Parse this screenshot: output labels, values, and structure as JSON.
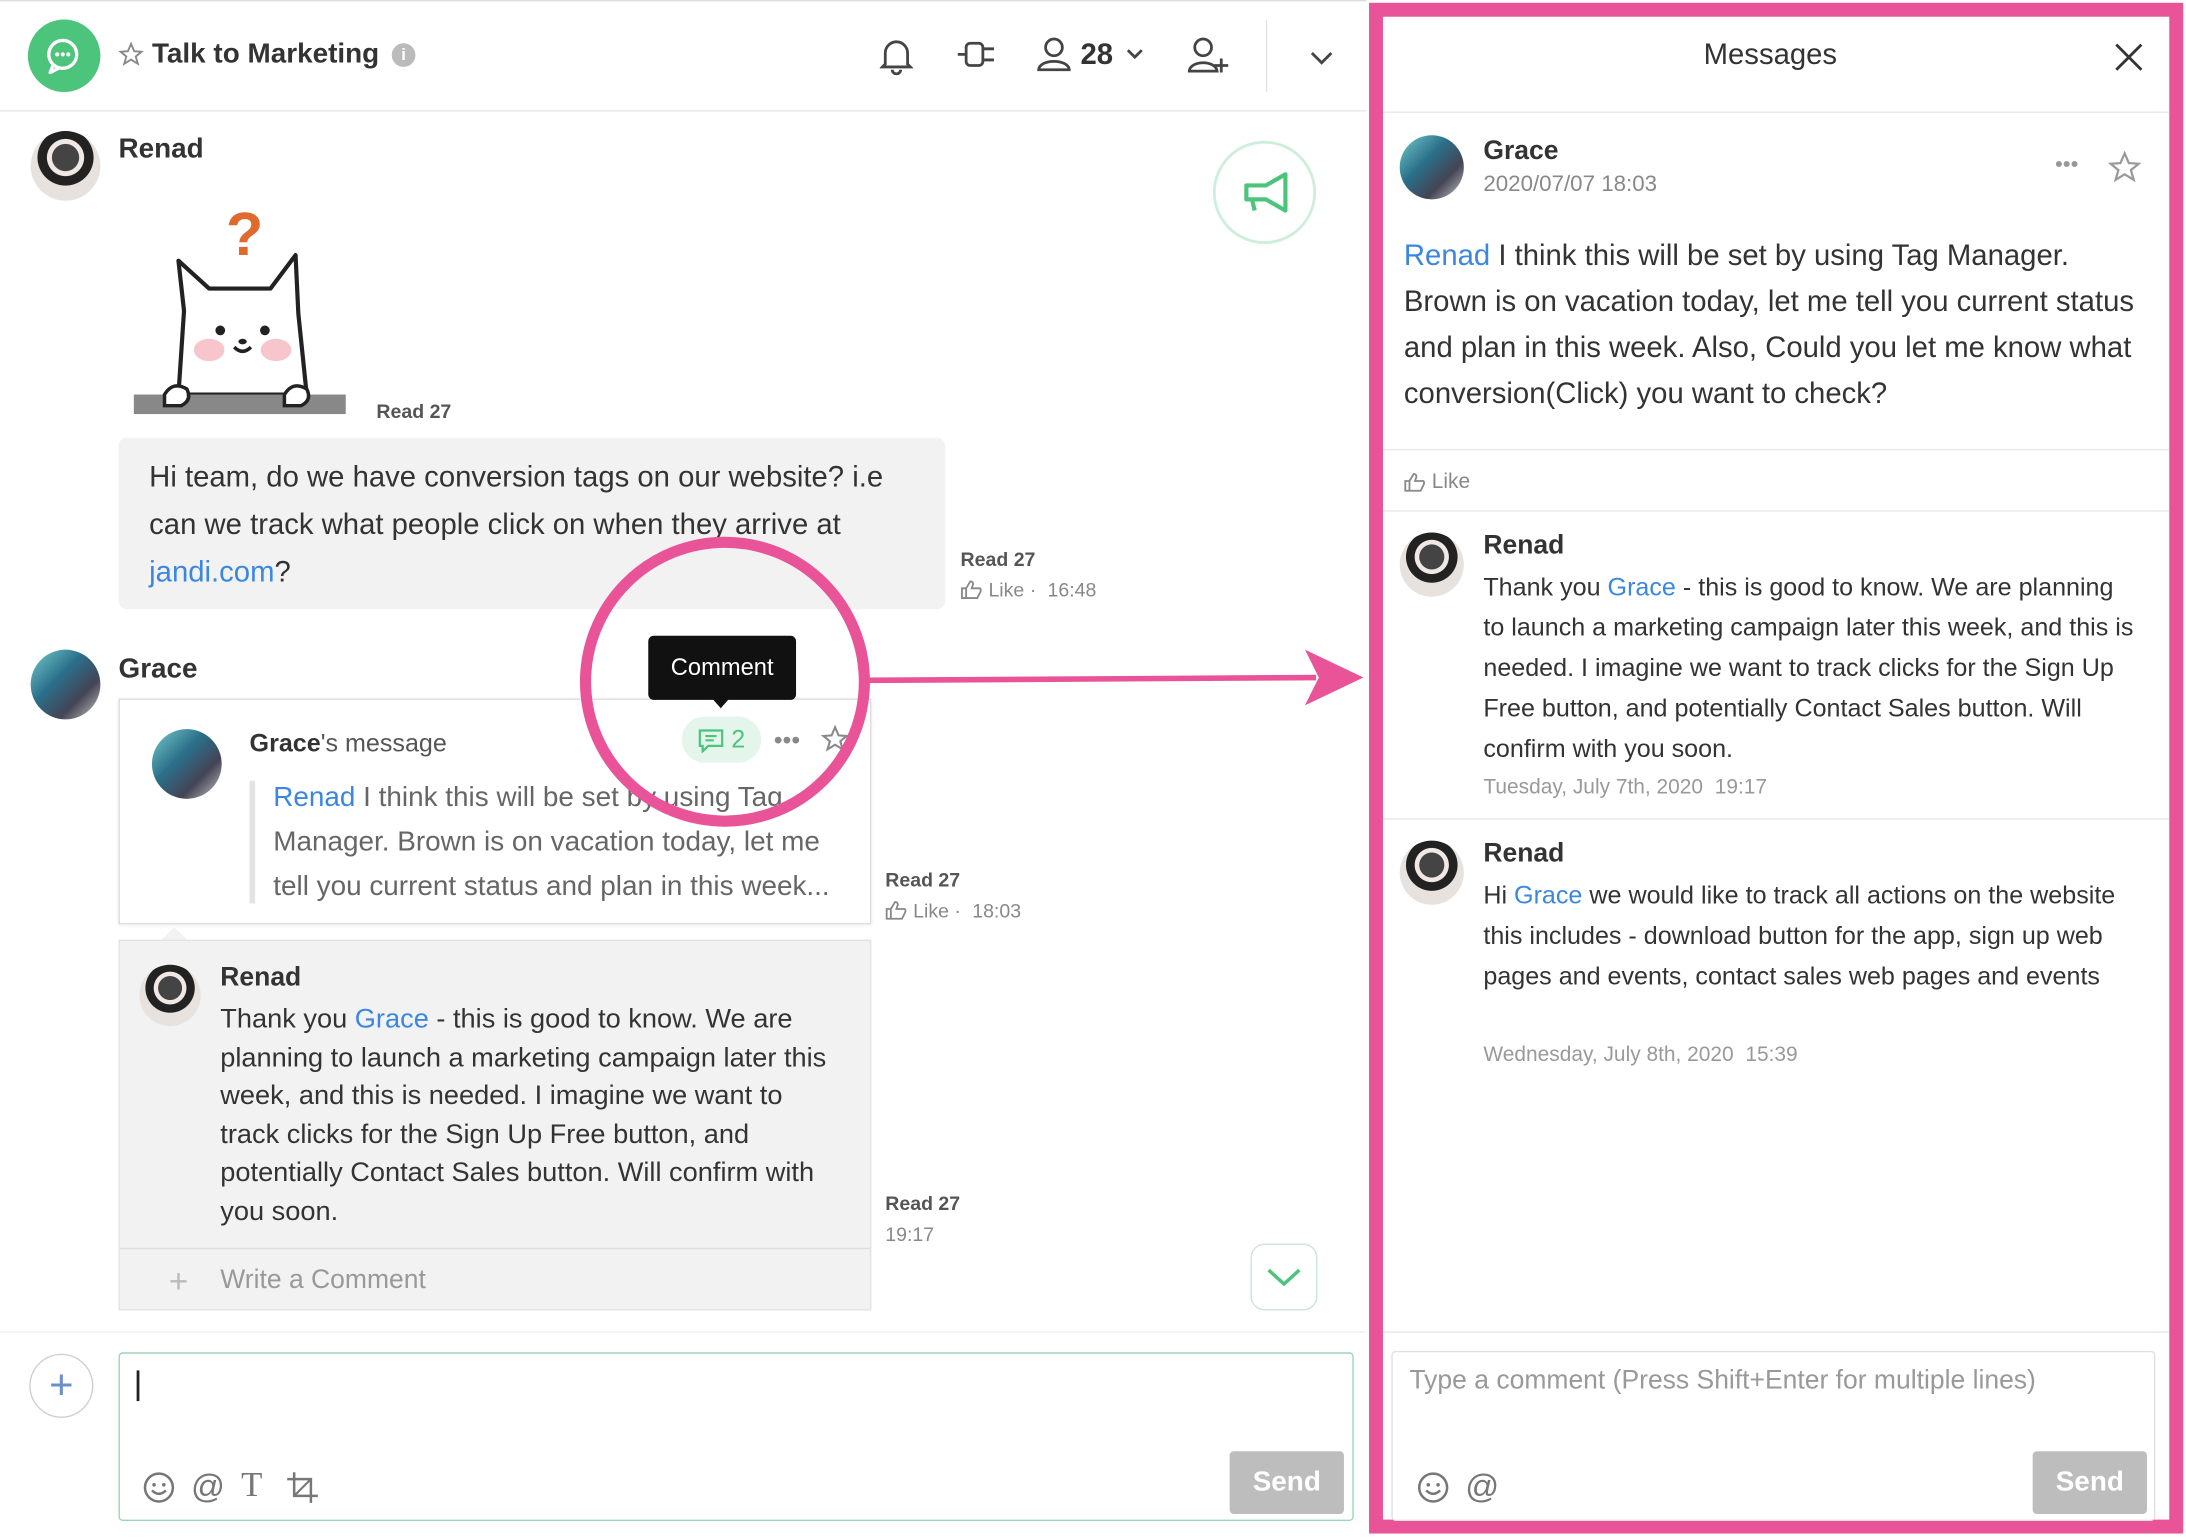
{
  "header": {
    "title": "Talk to Marketing",
    "member_count": "28"
  },
  "chat": {
    "messages": [
      {
        "author": "Renad",
        "sticker_read": "Read 27",
        "text_parts": [
          "Hi team, do we have conversion tags on our website? i.e can we track what people click on when they arrive at ",
          "jandi.com",
          "?"
        ],
        "read": "Read 27",
        "like": "Like",
        "time": "16:48"
      },
      {
        "author": "Grace",
        "shared_title": "Grace",
        "shared_suffix": "'s message",
        "comment_count": "2",
        "shared_mention": "Renad",
        "shared_text": "I think this will be set by using Tag Manager. Brown is on vacation today, let me tell you current status and plan in this week...",
        "read": "Read 27",
        "like": "Like",
        "time": "18:03"
      },
      {
        "author": "Renad",
        "mention": "Grace",
        "text": "- this is good to know. We are planning to launch a marketing campaign later this week, and this is needed. I imagine we want to track clicks for the Sign Up Free button, and potentially Contact Sales button. Will confirm with you soon.",
        "text_prefix": "Thank you",
        "read": "Read 27",
        "time": "19:17"
      }
    ],
    "tooltip": "Comment",
    "write_comment": "Write a Comment",
    "send_label": "Send"
  },
  "panel": {
    "title": "Messages",
    "post": {
      "author": "Grace",
      "date": "2020/07/07 18:03",
      "mention": "Renad",
      "text": "I think this will be set by using Tag Manager. Brown is on vacation today, let me tell you current status and plan in this week. Also, Could you let me know what conversion(Click) you want to check?",
      "like": "Like"
    },
    "comments": [
      {
        "author": "Renad",
        "prefix": "Thank you",
        "mention": "Grace",
        "text": "- this is good to know. We are planning to launch a marketing campaign later this week, and this is needed. I imagine we want to track clicks for the Sign Up Free button, and potentially Contact Sales button. Will confirm with you soon.",
        "date": "Tuesday, July 7th, 2020",
        "time": "19:17"
      },
      {
        "author": "Renad",
        "prefix": "Hi",
        "mention": "Grace",
        "text": "we would like to track all actions on the website this includes - download button for the app, sign up web pages and events, contact sales web pages and events",
        "date": "Wednesday, July 8th, 2020",
        "time": "15:39"
      }
    ],
    "comment_placeholder": "Type a comment (Press Shift+Enter for multiple lines)",
    "send_label": "Send"
  },
  "colors": {
    "accent": "#4cc47c",
    "highlight": "#e95499",
    "link": "#3b87e0"
  }
}
